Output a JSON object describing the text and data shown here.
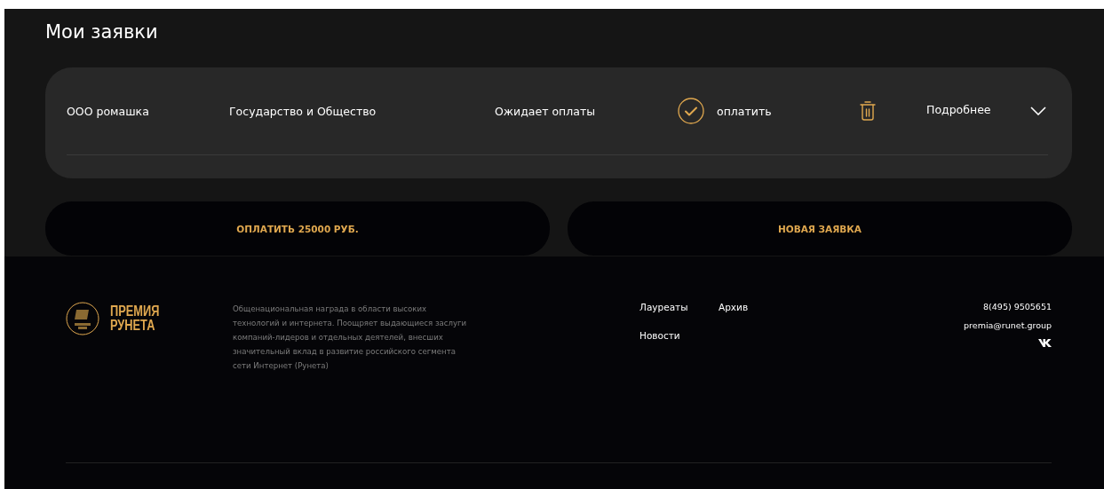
{
  "page_title": "Мои заявки",
  "applications": [
    {
      "company": "ООО ромашка",
      "nomination": "Государство и Общество",
      "status": "Ожидает оплаты",
      "pay_link": "оплатить",
      "details_link": "Подробнее",
      "expanded": false
    }
  ],
  "buttons": [
    "ОПЛАТИТЬ 25000 РУБ.",
    "НОВАЯ ЗАЯВКА"
  ],
  "footer": {
    "logo_text": [
      "ПРЕМИЯ",
      "РУНЕТА"
    ],
    "description": "Общенациональная награда в области высоких технологий и интернета. Поощряет выдающиеся заслуги компаний-лидеров и отдельных деятелей, внесших значительный вклад в развитие российского сегмента сети Интернет (Рунета)",
    "nav_links": [
      "Лауреаты",
      "Архив",
      "Новости"
    ],
    "phone": "8(495) 9505651",
    "email": "premia@runet.group"
  }
}
